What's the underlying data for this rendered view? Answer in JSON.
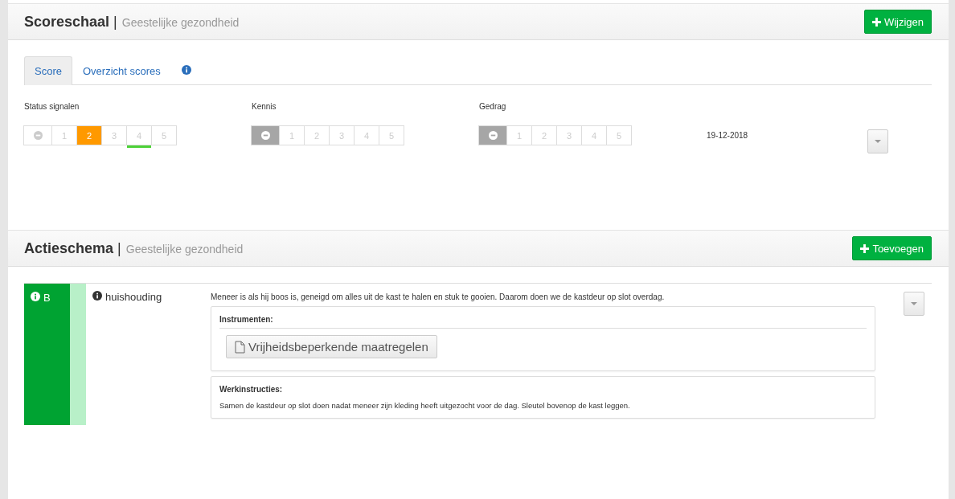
{
  "score_panel": {
    "title": "Scoreschaal",
    "separator": "|",
    "subtitle": "Geestelijke gezondheid",
    "button": "Wijzigen",
    "tabs": [
      {
        "kind": "text",
        "label": "Score",
        "selected": true
      },
      {
        "kind": "text",
        "label": "Overzicht scores",
        "selected": false
      },
      {
        "kind": "info",
        "selected": false
      }
    ],
    "scales": [
      {
        "label": "Status signalen",
        "options": [
          {
            "kind": "none",
            "selected": false,
            "target": false
          },
          {
            "kind": "number",
            "label": "1",
            "selected": false,
            "target": false
          },
          {
            "kind": "number",
            "label": "2",
            "selected": true,
            "target": false
          },
          {
            "kind": "number",
            "label": "3",
            "selected": false,
            "target": false
          },
          {
            "kind": "number",
            "label": "4",
            "selected": false,
            "target": true
          },
          {
            "kind": "number",
            "label": "5",
            "selected": false,
            "target": false
          }
        ]
      },
      {
        "label": "Kennis",
        "options": [
          {
            "kind": "none",
            "selected": true,
            "target": false
          },
          {
            "kind": "number",
            "label": "1",
            "selected": false,
            "target": false
          },
          {
            "kind": "number",
            "label": "2",
            "selected": false,
            "target": false
          },
          {
            "kind": "number",
            "label": "3",
            "selected": false,
            "target": false
          },
          {
            "kind": "number",
            "label": "4",
            "selected": false,
            "target": false
          },
          {
            "kind": "number",
            "label": "5",
            "selected": false,
            "target": false
          }
        ]
      },
      {
        "label": "Gedrag",
        "options": [
          {
            "kind": "none",
            "selected": true,
            "target": false
          },
          {
            "kind": "number",
            "label": "1",
            "selected": false,
            "target": false
          },
          {
            "kind": "number",
            "label": "2",
            "selected": false,
            "target": false
          },
          {
            "kind": "number",
            "label": "3",
            "selected": false,
            "target": false
          },
          {
            "kind": "number",
            "label": "4",
            "selected": false,
            "target": false
          },
          {
            "kind": "number",
            "label": "5",
            "selected": false,
            "target": false
          }
        ]
      }
    ],
    "date": "19-12-2018"
  },
  "action_panel": {
    "title": "Actieschema",
    "separator": "|",
    "subtitle": "Geestelijke gezondheid",
    "button": "Toevoegen",
    "items": [
      {
        "code": "B",
        "color": "#00a332",
        "category": "huishouding",
        "description": "Meneer is als hij boos is, geneigd om alles uit de kast te halen en stuk te gooien. Daarom doen we de kastdeur op slot overdag.",
        "instruments_title": "Instrumenten:",
        "instruments": [
          "Vrijheidsbeperkende maatregelen"
        ],
        "instructions_title": "Werkinstructies:",
        "instructions": "Samen de kastdeur op slot doen nadat meneer zijn kleding heeft uitgezocht voor de dag. Sleutel bovenop de kast leggen."
      }
    ]
  }
}
